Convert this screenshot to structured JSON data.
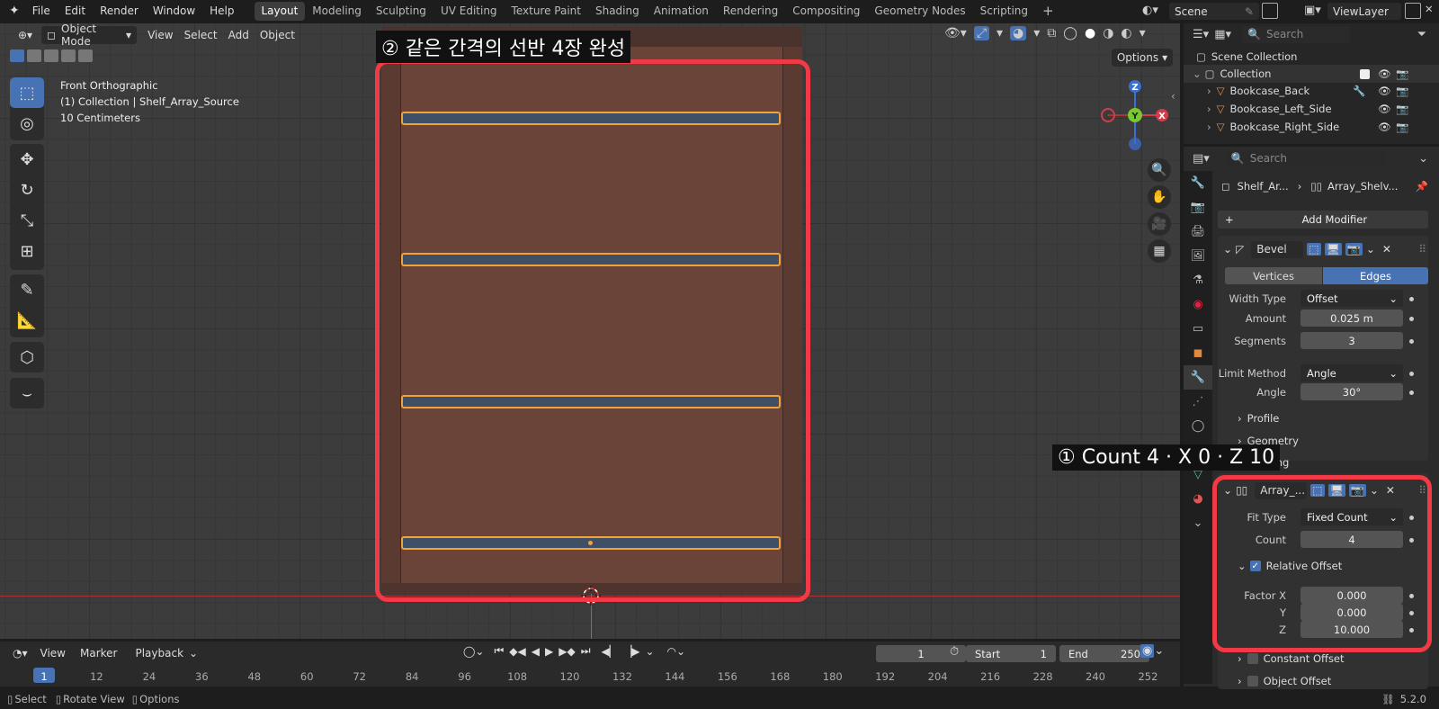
{
  "menu": [
    "File",
    "Edit",
    "Render",
    "Window",
    "Help"
  ],
  "workspaces": [
    "Layout",
    "Modeling",
    "Sculpting",
    "UV Editing",
    "Texture Paint",
    "Shading",
    "Animation",
    "Rendering",
    "Compositing",
    "Geometry Nodes",
    "Scripting"
  ],
  "workspace_add": "+",
  "scene": "Scene",
  "viewlayer": "ViewLayer",
  "viewport": {
    "mode": "Object Mode",
    "menus": [
      "View",
      "Select",
      "Add",
      "Object"
    ],
    "options_label": "Options",
    "info_lines": [
      "Front Orthographic",
      "(1) Collection | Shelf_Array_Source",
      "10 Centimeters"
    ],
    "gizmo": {
      "z": "Z",
      "y": "Y",
      "x": "X"
    },
    "shelf_count": 4
  },
  "annotations": {
    "top": "② 같은 간격의 선반 4장 완성",
    "right": "① Count 4 · X 0 · Z 10"
  },
  "outliner": {
    "search_placeholder": "Search",
    "scene_collection": "Scene Collection",
    "collection": "Collection",
    "items": [
      "Bookcase_Back",
      "Bookcase_Left_Side",
      "Bookcase_Right_Side"
    ]
  },
  "properties": {
    "search_placeholder": "Search",
    "breadcrumb": [
      "Shelf_Ar...",
      "Array_Shelv..."
    ],
    "add_modifier": "Add Modifier",
    "bevel": {
      "name": "Bevel",
      "tabs": [
        "Vertices",
        "Edges"
      ],
      "active_tab": "Edges",
      "width_type_label": "Width Type",
      "width_type": "Offset",
      "amount_label": "Amount",
      "amount": "0.025 m",
      "segments_label": "Segments",
      "segments": "3",
      "limit_label": "Limit Method",
      "limit": "Angle",
      "angle_label": "Angle",
      "angle": "30°",
      "profile": "Profile",
      "geometry": "Geometry",
      "shading": "Shading"
    },
    "array": {
      "name": "Array_...",
      "fit_type_label": "Fit Type",
      "fit_type": "Fixed Count",
      "count_label": "Count",
      "count": "4",
      "relative_offset": "Relative Offset",
      "factor_x_label": "Factor X",
      "factor_x": "0.000",
      "y_label": "Y",
      "y": "0.000",
      "z_label": "Z",
      "z": "10.000",
      "constant_offset": "Constant Offset",
      "object_offset": "Object Offset"
    }
  },
  "timeline": {
    "menus": [
      "View",
      "Marker",
      "Playback"
    ],
    "frame": "1",
    "start_label": "Start",
    "start": "1",
    "end_label": "End",
    "end": "250",
    "ticks": [
      "1",
      "12",
      "24",
      "36",
      "48",
      "60",
      "72",
      "84",
      "96",
      "108",
      "120",
      "132",
      "144",
      "156",
      "168",
      "180",
      "192",
      "204",
      "216",
      "228",
      "240",
      "252"
    ]
  },
  "status": {
    "select": "Select",
    "rotate": "Rotate View",
    "options": "Options",
    "version": "5.2.0"
  },
  "colors": {
    "accent": "#4772b3",
    "annotation": "#f13a46",
    "shelf_outline": "#f2a23a",
    "bookcase": "#6a4439"
  }
}
